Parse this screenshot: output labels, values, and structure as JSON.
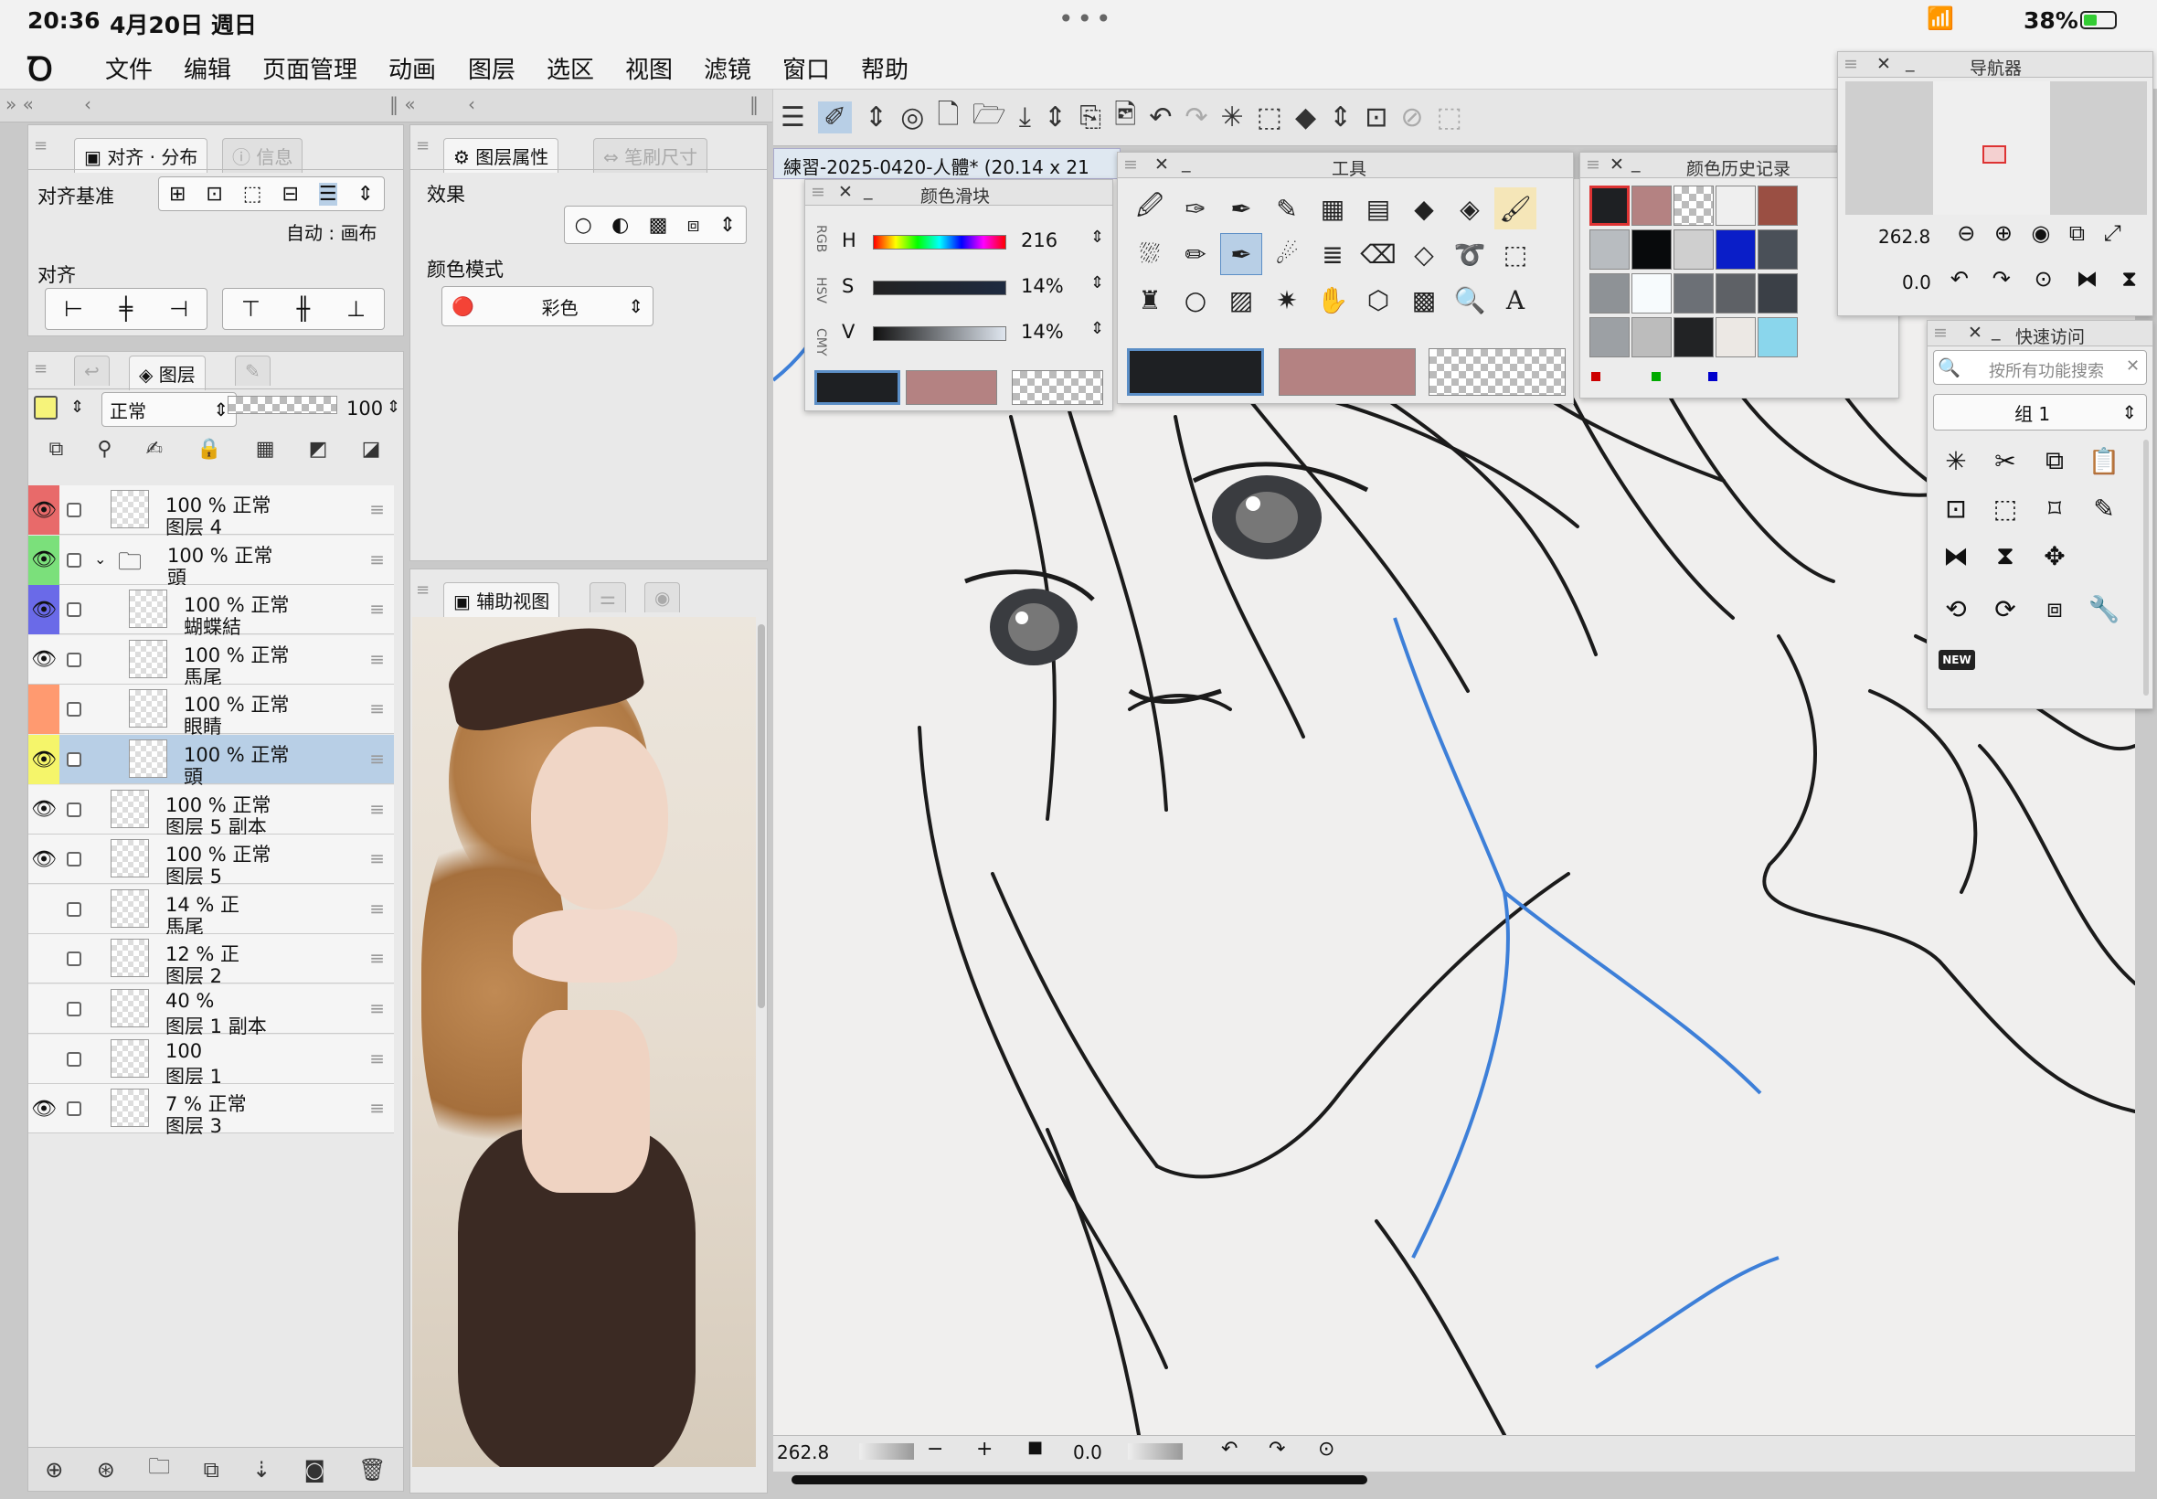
{
  "status": {
    "time": "20:36",
    "date": "4月20日 週日",
    "battery": "38%"
  },
  "menu": [
    "文件",
    "编辑",
    "页面管理",
    "动画",
    "图层",
    "选区",
    "视图",
    "滤镜",
    "窗口",
    "帮助"
  ],
  "align_panel": {
    "tab_active": "对齐 · 分布",
    "tab_inactive": "信息",
    "basis_label": "对齐基准",
    "auto_label": "自动 : 画布",
    "align_label": "对齐"
  },
  "layer_prop_panel": {
    "tab_active": "图层属性",
    "tab_inactive": "笔刷尺寸",
    "effect_label": "效果",
    "color_mode_label": "颜色模式",
    "color_mode_value": "彩色"
  },
  "sub_view_panel": {
    "tab_active": "辅助视图"
  },
  "layers_panel": {
    "tab_label": "图层",
    "blend_mode": "正常",
    "opacity": "100",
    "layers": [
      {
        "mode": "100 % 正常",
        "name": "图层 4",
        "eye": true,
        "color": "#e86a6a",
        "indent": 0
      },
      {
        "mode": "100 % 正常",
        "name": "頭",
        "eye": true,
        "color": "#7be07b",
        "folder": true,
        "indent": 0
      },
      {
        "mode": "100 % 正常",
        "name": "蝴蝶結",
        "eye": true,
        "color": "#6a6ae8",
        "indent": 1
      },
      {
        "mode": "100 % 正常",
        "name": "馬尾",
        "eye": true,
        "color": "",
        "indent": 1
      },
      {
        "mode": "100 % 正常",
        "name": "眼睛",
        "eye": false,
        "color": "#ff9a70",
        "indent": 1
      },
      {
        "mode": "100 % 正常",
        "name": "頭",
        "eye": true,
        "color": "#f5f56a",
        "selected": true,
        "indent": 1
      },
      {
        "mode": "100 % 正常",
        "name": "图层 5 副本",
        "eye": true,
        "color": "",
        "indent": 0
      },
      {
        "mode": "100 % 正常",
        "name": "图层 5",
        "eye": true,
        "color": "",
        "indent": 0
      },
      {
        "mode": "14 % 正",
        "name": "馬尾",
        "eye": false,
        "color": "",
        "indent": 0
      },
      {
        "mode": "12 % 正",
        "name": "图层 2",
        "eye": false,
        "color": "",
        "indent": 0
      },
      {
        "mode": "40 %",
        "name": "图层 1 副本",
        "eye": false,
        "color": "",
        "indent": 0
      },
      {
        "mode": "100",
        "name": "图层 1",
        "eye": false,
        "color": "",
        "indent": 0
      },
      {
        "mode": "7 % 正常",
        "name": "图层 3",
        "eye": true,
        "color": "",
        "indent": 0
      }
    ]
  },
  "canvas": {
    "doc_title": "練習-2025-0420-人體* (20.14 x 21",
    "zoom": "262.8",
    "rotation": "0.0"
  },
  "color_slider": {
    "title": "颜色滑块",
    "tabs": [
      "RGB",
      "HSV",
      "CMY"
    ],
    "h_label": "H",
    "h_value": "216",
    "s_label": "S",
    "s_value": "14%",
    "v_label": "V",
    "v_value": "14%",
    "main_color": "#1e2023",
    "sub_color": "#b48282"
  },
  "tools_panel": {
    "title": "工具"
  },
  "color_history": {
    "title": "颜色历史记录",
    "swatches": [
      "#1e2023",
      "#b48282",
      "checker",
      "#efefef",
      "#9a4f43",
      "#b8bcc0",
      "#080a0c",
      "#cfcfcf",
      "#0a1ec8",
      "#4a5058",
      "#8e9296",
      "#f7fbfd",
      "#6c7076",
      "#5e6166",
      "#3b4047",
      "#9ca0a4",
      "#bcbcbc",
      "#222325",
      "#ece8e4",
      "#8ad6ec"
    ]
  },
  "navigator": {
    "title": "导航器",
    "zoom": "262.8",
    "rotation": "0.0"
  },
  "quick_access": {
    "title": "快速访问",
    "search_placeholder": "按所有功能搜索",
    "group": "组 1",
    "new_badge": "NEW"
  },
  "colors": {
    "accent": "#5b8ec6",
    "selected_row": "#b8cfe6",
    "panel": "#e9e9e9"
  }
}
